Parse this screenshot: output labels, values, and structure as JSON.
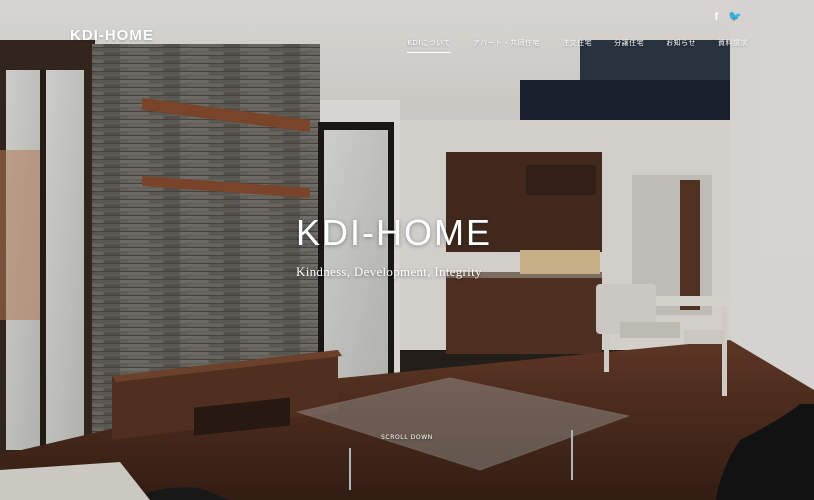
{
  "header": {
    "logo": "KDI-HOME",
    "nav": [
      {
        "label": "KDIについて",
        "active": true
      },
      {
        "label": "アパート・共同住宅",
        "active": false
      },
      {
        "label": "注文住宅",
        "active": false
      },
      {
        "label": "分譲住宅",
        "active": false
      },
      {
        "label": "お知らせ",
        "active": false
      },
      {
        "label": "資料請求",
        "active": false
      }
    ],
    "social": [
      {
        "icon": "facebook-icon",
        "glyph": "f"
      },
      {
        "icon": "twitter-icon",
        "glyph": "🐦"
      }
    ]
  },
  "hero": {
    "title": "KDI-HOME",
    "tagline": "Kindness, Development, Integrity",
    "scroll_label": "SCROLL DOWN"
  },
  "colors": {
    "text": "#ffffff",
    "wood_dark": "#4a2f22",
    "wood_floor": "#5b3524",
    "stone_wall": "#6d6b66",
    "ceiling": "#f0efeb"
  }
}
